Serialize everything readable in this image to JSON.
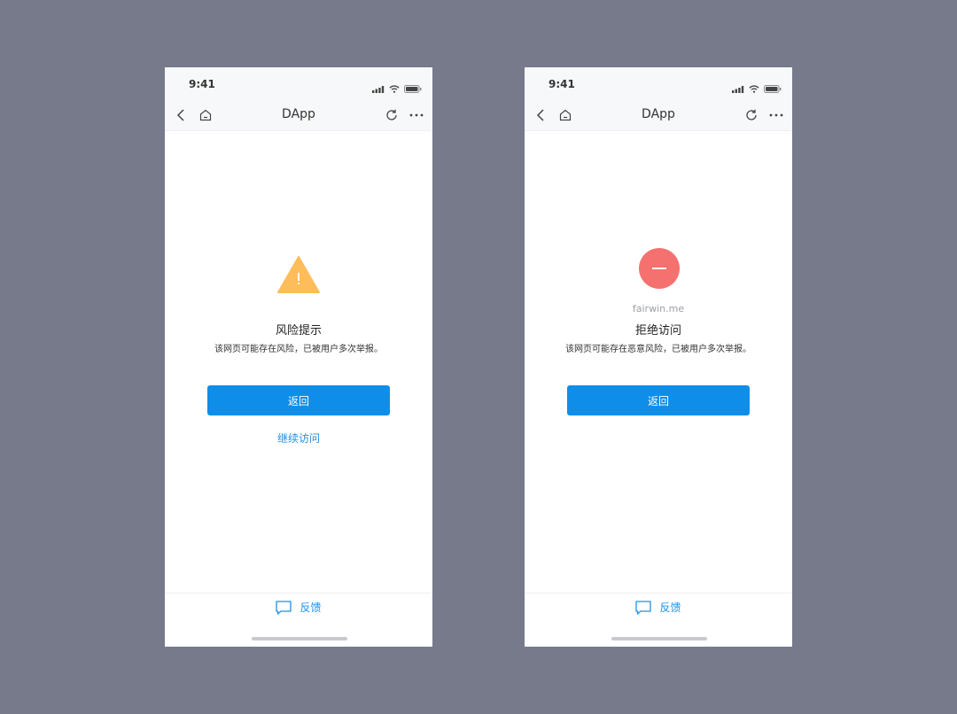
{
  "screens": [
    {
      "status_time": "9:41",
      "nav_title": "DApp",
      "icon": "warning-icon",
      "title": "风险提示",
      "description": "该网页可能存在风险，已被用户多次举报。",
      "primary_button": "返回",
      "secondary_link": "继续访问",
      "feedback_label": "反馈"
    },
    {
      "status_time": "9:41",
      "nav_title": "DApp",
      "icon": "blocked-icon",
      "domain": "fairwin.me",
      "title": "拒绝访问",
      "description": "该网页可能存在恶意风险，已被用户多次举报。",
      "primary_button": "返回",
      "feedback_label": "反馈"
    }
  ],
  "colors": {
    "background": "#777a8b",
    "primary": "#0e8ee9",
    "link": "#1f8fe6",
    "warning": "#fdbd5b",
    "danger": "#f4716f"
  }
}
